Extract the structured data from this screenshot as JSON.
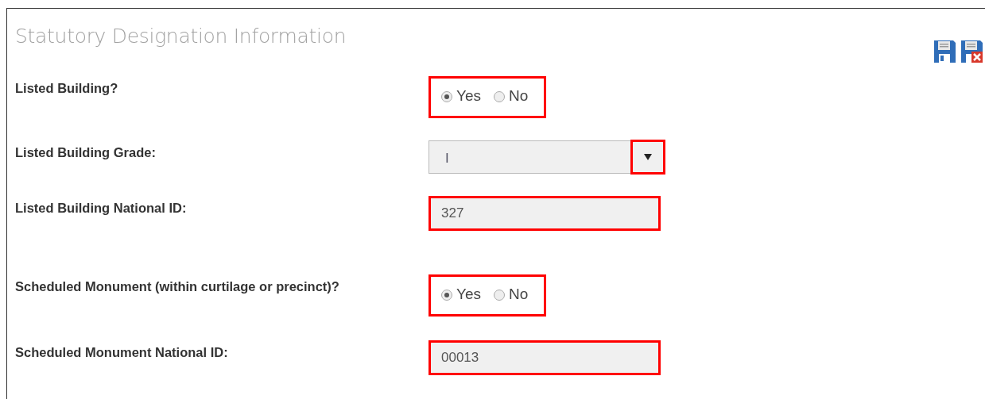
{
  "panel": {
    "title": "Statutory Designation Information"
  },
  "fields": [
    {
      "kind": "radio",
      "label": "Listed Building?",
      "highlighted": true,
      "options": [
        {
          "label": "Yes",
          "selected": true
        },
        {
          "label": "No",
          "selected": false
        }
      ]
    },
    {
      "kind": "select",
      "label": "Listed Building Grade:",
      "value": "I",
      "highlighted": true
    },
    {
      "kind": "text",
      "label": "Listed Building National ID:",
      "value": "327",
      "highlighted": true
    },
    {
      "kind": "radio",
      "label": "Scheduled Monument (within curtilage or precinct)?",
      "highlighted": true,
      "options": [
        {
          "label": "Yes",
          "selected": true
        },
        {
          "label": "No",
          "selected": false
        }
      ]
    },
    {
      "kind": "text",
      "label": "Scheduled Monument National ID:",
      "value": "00013",
      "highlighted": true
    }
  ]
}
